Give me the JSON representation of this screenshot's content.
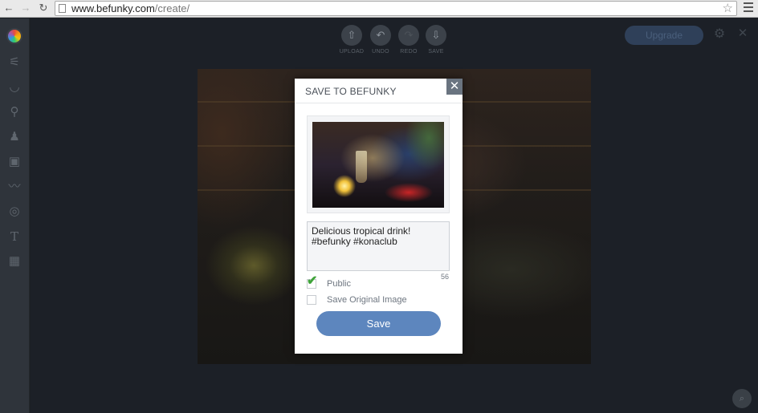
{
  "browser": {
    "url_host": "www.befunky.com",
    "url_path": "/create/"
  },
  "toolbar": {
    "tools": [
      {
        "name": "adjust-icon",
        "glyph": "⚟"
      },
      {
        "name": "lips-icon",
        "glyph": "◡"
      },
      {
        "name": "touch-up-icon",
        "glyph": "⚲"
      },
      {
        "name": "brush-icon",
        "glyph": "♟"
      },
      {
        "name": "frame-icon",
        "glyph": "▣"
      },
      {
        "name": "mustache-icon",
        "glyph": "〰"
      },
      {
        "name": "shape-icon",
        "glyph": "◎"
      },
      {
        "name": "text-icon",
        "glyph": "T"
      },
      {
        "name": "texture-icon",
        "glyph": "▦"
      }
    ]
  },
  "actions": {
    "upload": "UPLOAD",
    "undo": "UNDO",
    "redo": "REDO",
    "save": "SAVE"
  },
  "header": {
    "upgrade_label": "Upgrade"
  },
  "modal": {
    "title": "SAVE TO BEFUNKY",
    "close_glyph": "✕",
    "caption": "Delicious tropical drink! #befunky #konaclub",
    "char_count": "56",
    "public_label": "Public",
    "public_checked": true,
    "original_label": "Save Original Image",
    "original_checked": false,
    "save_label": "Save"
  },
  "colors": {
    "save_button": "#5d86be",
    "checkmark": "#3fa33a",
    "background": "#1c2027"
  }
}
